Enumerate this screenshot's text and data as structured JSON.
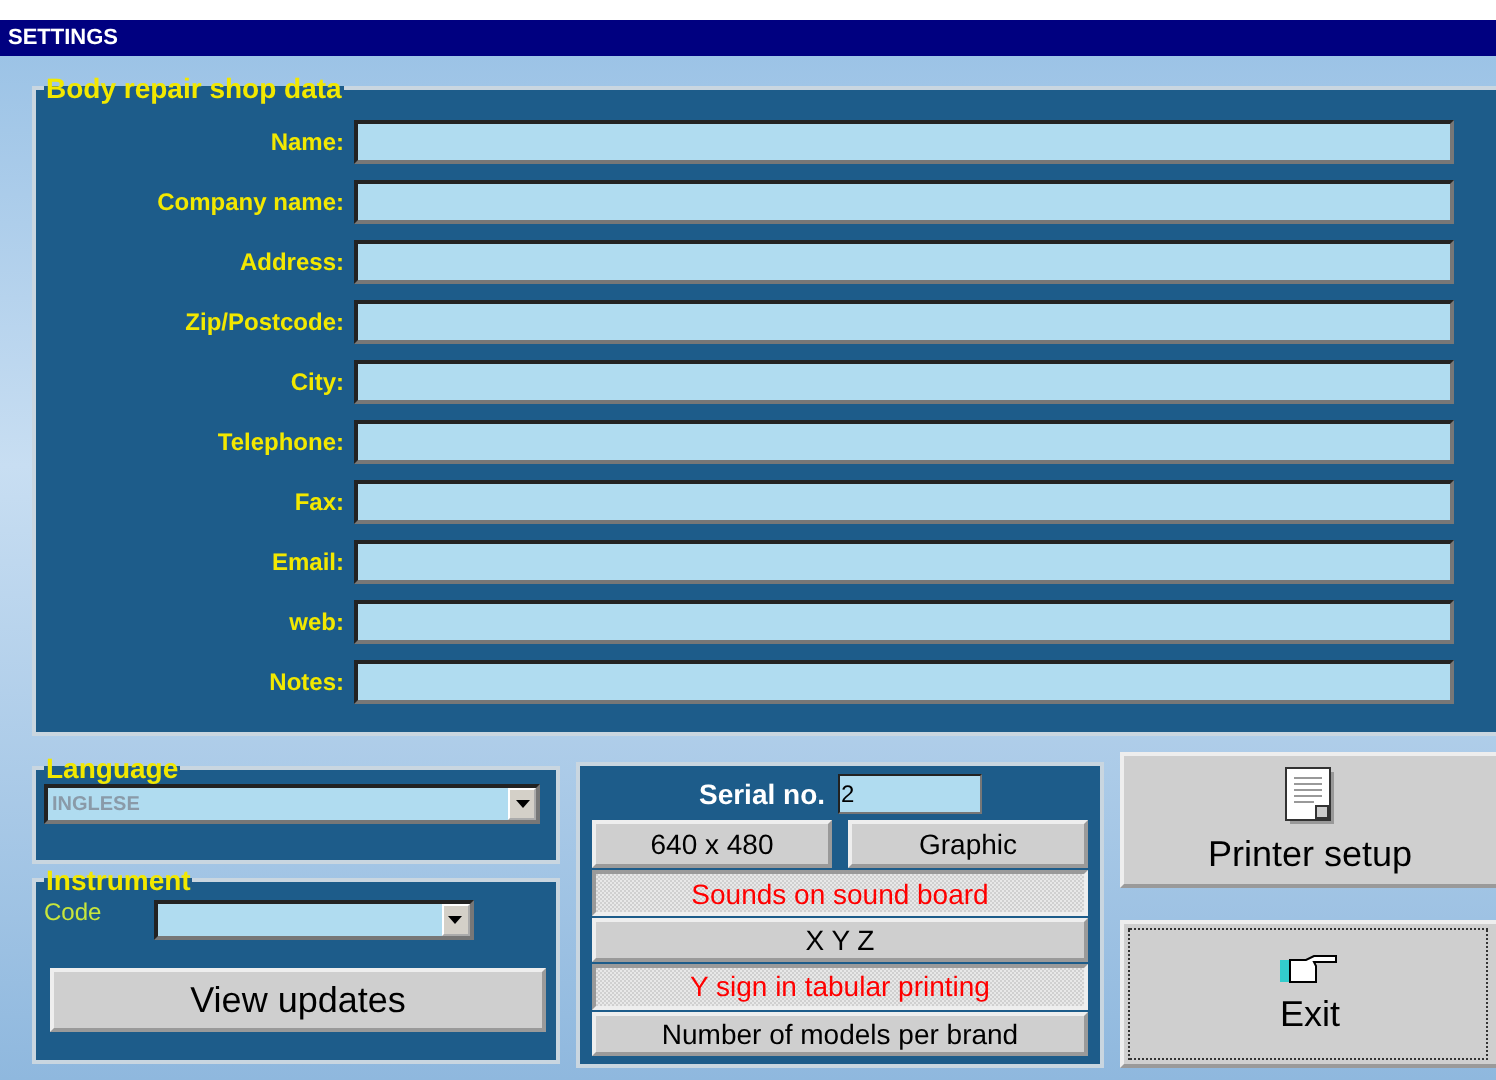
{
  "window": {
    "title": "SETTINGS"
  },
  "shop_data": {
    "title": "Body repair shop data",
    "fields": [
      {
        "label": "Name:"
      },
      {
        "label": "Company name:"
      },
      {
        "label": "Address:"
      },
      {
        "label": "Zip/Postcode:"
      },
      {
        "label": "City:"
      },
      {
        "label": "Telephone:"
      },
      {
        "label": "Fax:"
      },
      {
        "label": "Email:"
      },
      {
        "label": "web:"
      },
      {
        "label": "Notes:"
      }
    ]
  },
  "language": {
    "title": "Language",
    "value": "INGLESE"
  },
  "instrument": {
    "title": "Instrument",
    "code_label": "Code"
  },
  "view_updates": "View updates",
  "serial": {
    "label": "Serial no.",
    "value": "2"
  },
  "mode_buttons": [
    "640 x 480",
    "Graphic"
  ],
  "options": [
    {
      "label": "Sounds on sound board",
      "on": true
    },
    {
      "label": "X Y Z",
      "on": false
    },
    {
      "label": "Y sign in tabular printing",
      "on": true
    },
    {
      "label": "Number of models per brand",
      "on": false
    }
  ],
  "printer_setup": "Printer setup",
  "exit": "Exit"
}
